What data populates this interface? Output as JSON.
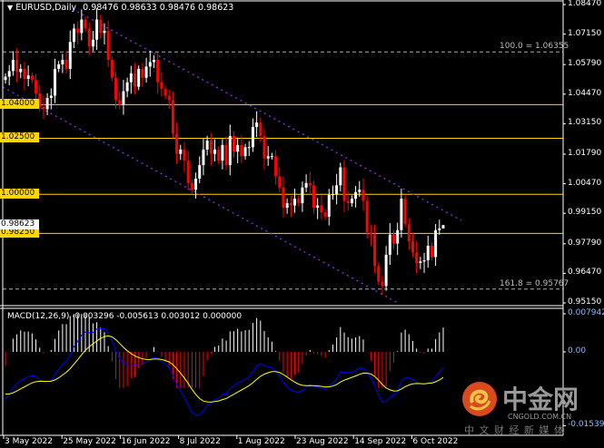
{
  "header": {
    "symbol": "EURUSD,Daily",
    "ohlc": "0.98476 0.98633 0.98476 0.98623",
    "menu_icon": "triangle-down-icon"
  },
  "macd_header": {
    "label": "MACD(12,26,9)",
    "values": "-0.003296 -0.005613 0.003012 0.000000"
  },
  "colors": {
    "background": "#000000",
    "bull": "#ffffff",
    "bear": "#ff0000",
    "level": "#ffd700",
    "channel": "#9b30ff",
    "macd_line": "#0000ff",
    "signal_line": "#ffff00"
  },
  "chart_data": [
    {
      "type": "candlestick",
      "title": "EURUSD,Daily",
      "ylim": [
        0.9515,
        1.0847
      ],
      "y_ticks": [
        "1.08470",
        "1.07150",
        "1.05790",
        "1.04470",
        "1.03150",
        "1.01790",
        "1.00470",
        "0.99150",
        "0.97790",
        "0.96470",
        "0.95150"
      ],
      "x_ticks": [
        "3 May 2022",
        "25 May 2022",
        "16 Jun 2022",
        "8 Jul 2022",
        "1 Aug 2022",
        "23 Aug 2022",
        "14 Sep 2022",
        "6 Oct 2022"
      ],
      "first_open": 1.051,
      "last_bar": {
        "open": 0.98476,
        "high": 0.98633,
        "low": 0.98476,
        "close": 0.98623
      },
      "closes": [
        1.0525,
        1.055,
        1.06,
        1.0545,
        1.056,
        1.0515,
        1.053,
        1.051,
        1.045,
        1.039,
        1.038,
        1.043,
        1.044,
        1.056,
        1.058,
        1.06,
        1.056,
        1.068,
        1.074,
        1.072,
        1.078,
        1.074,
        1.066,
        1.069,
        1.078,
        1.072,
        1.073,
        1.06,
        1.052,
        1.042,
        1.04,
        1.046,
        1.05,
        1.054,
        1.048,
        1.056,
        1.052,
        1.057,
        1.059,
        1.06,
        1.05,
        1.047,
        1.044,
        1.042,
        1.027,
        1.018,
        1.02,
        1.015,
        1.005,
        1.002,
        1.007,
        1.013,
        1.02,
        1.024,
        1.018,
        1.02,
        1.015,
        1.022,
        1.013,
        1.026,
        1.019,
        1.022,
        1.017,
        1.021,
        1.021,
        1.03,
        1.032,
        1.026,
        1.016,
        1.017,
        1.017,
        1.008,
        1.003,
        0.994,
        0.996,
        0.995,
        0.998,
        0.996,
        1.003,
        1.005,
        1.004,
        0.994,
        0.995,
        0.992,
        0.99,
        0.9997,
        1.0,
        1.004,
        1.012,
        0.997,
        0.996,
        0.998,
        1.001,
        1.002,
        0.997,
        0.983,
        0.982,
        0.968,
        0.961,
        0.959,
        0.973,
        0.982,
        0.978,
        0.984,
        0.998,
        0.9867,
        0.979,
        0.974,
        0.9693,
        0.97,
        0.9705,
        0.977,
        0.972,
        0.984,
        0.98476,
        0.98623
      ],
      "levels": [
        {
          "price": 1.04,
          "label": "1.04000"
        },
        {
          "price": 1.025,
          "label": "1.02500"
        },
        {
          "price": 1.0,
          "label": "1.00000"
        },
        {
          "price": 0.9825,
          "label": "0.98250"
        }
      ],
      "fibo": [
        {
          "price": 1.06355,
          "label": "100.0 = 1.06355"
        },
        {
          "price": 0.95767,
          "label": "161.8 = 0.95767"
        }
      ],
      "current_price": "0.98623"
    },
    {
      "type": "macd",
      "title": "MACD(12,26,9)",
      "ylim": [
        -0.015396,
        0.007942
      ],
      "y_ticks": [
        "0.007942",
        "0.00",
        "-0.015396"
      ],
      "last_values": {
        "macd": -0.003296,
        "signal": -0.005613,
        "histogram": 0.003012,
        "extra": 0.0
      }
    }
  ],
  "watermark": {
    "brand": "中金网",
    "domain": "CNGOLD.COM.CN",
    "tagline": "中 文 财 经 新 媒 体"
  }
}
